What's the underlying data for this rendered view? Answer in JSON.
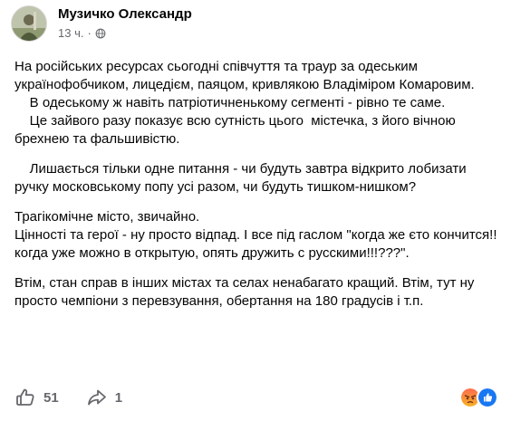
{
  "post": {
    "author": "Музичко Олександр",
    "time": "13 ч.",
    "separator": "·",
    "paragraphs": [
      [
        "На російських ресурсах сьогодні співчуття та траур за одеським українофобчиком, лицедієм, паяцом, кривлякою Владіміром Комаровим.",
        "    В одеському ж навіть патріотичненькому сегменті - рівно те саме.",
        "    Це зайвого разу показує всю сутність цього  містечка, з його вічною брехнею та фальшивістю."
      ],
      [
        "    Лишається тільки одне питання - чи будуть завтра відкрито лобизати ручку московському попу усі разом, чи будуть тишком-нишком?"
      ],
      [
        "Трагікомічне місто, звичайно.",
        "Цінності та герої - ну просто відпад. І все під гаслом \"когда же єто кончится!! когда уже можно в открытую, опять дружить с русскими!!!???\"."
      ],
      [
        "Втім, стан справ в інших містах та селах ненабагато кращий. Втім, тут ну просто чемпіони з перевзування, обертання на 180 градусів і т.п."
      ]
    ]
  },
  "footer": {
    "likes": "51",
    "shares": "1"
  },
  "icons": {
    "audience": "globe-icon",
    "like": "thumbs-up-icon",
    "share": "share-arrow-icon",
    "reactions": [
      "angry-reaction-icon",
      "like-reaction-icon"
    ]
  },
  "colors": {
    "text": "#050505",
    "secondary": "#65676b",
    "like_blue": "#1877f2",
    "angry_top": "#ff6b4d",
    "angry_bottom": "#f7b125"
  }
}
